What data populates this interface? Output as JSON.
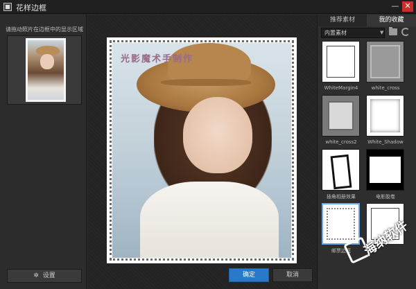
{
  "window": {
    "title": "花样边框",
    "minimize_glyph": "—",
    "close_glyph": "✕"
  },
  "left_panel": {
    "hint": "请拖动照片在边框中的显示区域",
    "settings_label": "设置",
    "settings_icon": "gear-icon"
  },
  "canvas": {
    "photo_caption": "光影魔术手制作"
  },
  "footer": {
    "ok_label": "确定",
    "cancel_label": "取消",
    "ok_color": "#2a78c9"
  },
  "right_panel": {
    "tabs": [
      {
        "label": "推荐素材",
        "active": false
      },
      {
        "label": "我的收藏",
        "active": true
      }
    ],
    "dropdown": {
      "value": "内置素材"
    },
    "items": [
      {
        "label": "WhiteMargin4"
      },
      {
        "label": "white_cross"
      },
      {
        "label": "white_cross2"
      },
      {
        "label": "White_Shadow"
      },
      {
        "label": "插角相册效果"
      },
      {
        "label": "电影胶卷"
      },
      {
        "label": "邮票边框"
      },
      {
        "label": ""
      }
    ]
  },
  "watermark": {
    "text": "海纳软件"
  }
}
